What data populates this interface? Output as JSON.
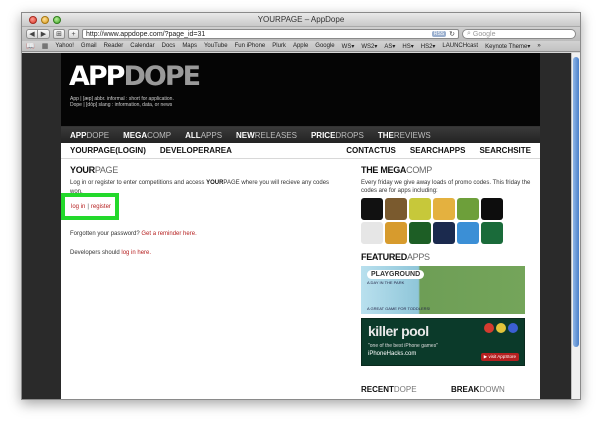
{
  "window": {
    "title": "YOURPAGE – AppDope"
  },
  "toolbar": {
    "back": "◀",
    "forward": "▶",
    "tabs": "⊞",
    "add": "+",
    "url": "http://www.appdope.com/?page_id=31",
    "rss": "RSS",
    "reload": "↻",
    "search_placeholder": "Google"
  },
  "bookmarks": {
    "items": [
      "Yahoo!",
      "Gmail",
      "Reader",
      "Calendar",
      "Docs",
      "Maps",
      "YouTube",
      "Fun iPhone",
      "Plurk",
      "Apple",
      "Google",
      "WS▾",
      "WS2▾",
      "AS▾",
      "HS▾",
      "HS2▾",
      "LAUNCHcast",
      "Keynote Theme▾",
      "»"
    ]
  },
  "header": {
    "logo_app": "APP",
    "logo_dope": "DOPE",
    "tagline1": "App | [æp] abbr. informal : short for application.",
    "tagline2": "Dope | [dōp] slang : information, data, or news"
  },
  "mainnav": [
    {
      "bold": "APP",
      "rest": "DOPE"
    },
    {
      "bold": "MEGA",
      "rest": "COMP"
    },
    {
      "bold": "ALL",
      "rest": "APPS"
    },
    {
      "bold": "NEW",
      "rest": "RELEASES"
    },
    {
      "bold": "PRICE",
      "rest": "DROPS"
    },
    {
      "bold": "THE",
      "rest": "REVIEWS"
    }
  ],
  "subnav": {
    "left": [
      {
        "bold": "YOUR",
        "rest": "PAGE(LOGIN)"
      },
      {
        "bold": "DEVELOPER",
        "rest": "AREA"
      }
    ],
    "right": [
      {
        "bold": "CONTACT",
        "rest": "US"
      },
      {
        "bold": "SEARCH",
        "rest": "APPS"
      },
      {
        "bold": "SEARCH",
        "rest": "SITE"
      }
    ]
  },
  "yourpage": {
    "title_bold": "YOUR",
    "title_rest": "PAGE",
    "intro_a": "Log in or register to enter competitions and access ",
    "intro_bold": "YOUR",
    "intro_b": "PAGE where you will recieve any codes won.",
    "login": "log in",
    "sep": "|",
    "register": "register",
    "forgot_prefix": "Forgotten your password?",
    "forgot_link": "Get a reminder here.",
    "dev_prefix": "Developers should",
    "dev_link": "log in here."
  },
  "megacomp": {
    "title_bold": "THE ",
    "title_rest": "MEGA",
    "title_end": "COMP",
    "text": "Every friday we give away loads of promo codes. This friday the codes are for apps including:"
  },
  "featured": {
    "title_bold": "FEATURED",
    "title_rest": "APPS",
    "banner1_title": "PLAYGROUND",
    "banner1_sub": "A DAY IN THE PARK",
    "banner1_tag": "A GREAT GAME FOR TODDLERS!",
    "banner2_title": "killer pool",
    "banner2_quote": "\"one of the best iPhone games\"",
    "banner2_source": "iPhoneHacks.com",
    "banner2_store": "▶ visit AppStore"
  },
  "bottom": {
    "recent_bold": "RECENT",
    "recent_rest": "DOPE",
    "break_bold": "BREAK",
    "break_rest": "DOWN"
  }
}
